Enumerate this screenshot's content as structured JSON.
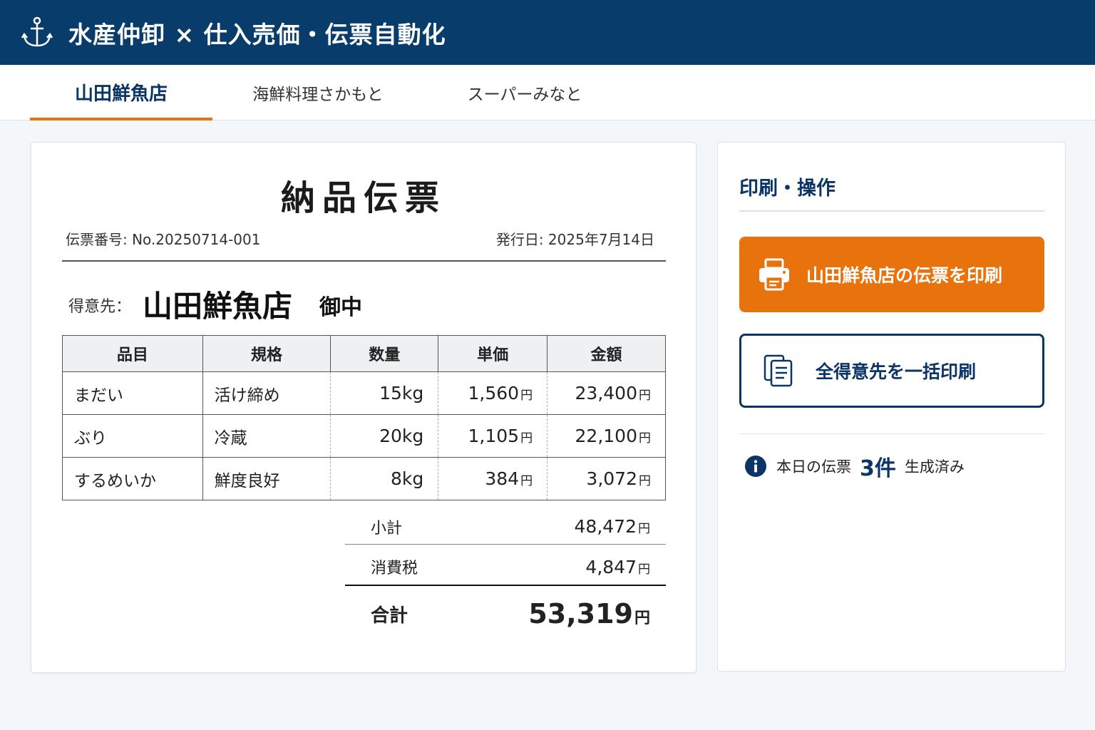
{
  "app": {
    "title": "水産仲卸 × 仕入売価・伝票自動化",
    "logo_icon": "anchor-icon"
  },
  "tabs": [
    {
      "label": "山田鮮魚店",
      "active": true
    },
    {
      "label": "海鮮料理さかもと",
      "active": false
    },
    {
      "label": "スーパーみなと",
      "active": false
    }
  ],
  "slip": {
    "title": "納品伝票",
    "number": "伝票番号: No.20250714-001",
    "date": "発行日: 2025年7月14日",
    "customer_label": "得意先：",
    "customer_name": "山田鮮魚店",
    "customer_suffix": "御中",
    "columns": [
      "品目",
      "規格",
      "数量",
      "単価",
      "金額"
    ],
    "yen": "円",
    "rows": [
      {
        "item": "まだい",
        "spec": "活け締め",
        "qty": "15kg",
        "price": "1,560",
        "amount": "23,400"
      },
      {
        "item": "ぶり",
        "spec": "冷蔵",
        "qty": "20kg",
        "price": "1,105",
        "amount": "22,100"
      },
      {
        "item": "するめいか",
        "spec": "鮮度良好",
        "qty": "8kg",
        "price": "384",
        "amount": "3,072"
      }
    ],
    "subtotal_label": "小計",
    "subtotal": "48,472",
    "tax_label": "消費税",
    "tax": "4,847",
    "total_label": "合計",
    "total": "53,319"
  },
  "panel": {
    "title": "印刷・操作",
    "print_button": "山田鮮魚店の伝票を印刷",
    "print_all_button": "全得意先を一括印刷",
    "info_prefix": "本日の伝票",
    "info_count": "3件",
    "info_suffix": "生成済み"
  },
  "colors": {
    "header": "#073c6b",
    "accent": "#e8720c",
    "navy": "#0b3566"
  }
}
